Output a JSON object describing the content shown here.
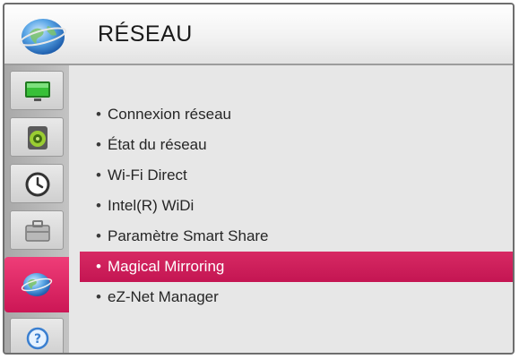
{
  "header": {
    "title": "RÉSEAU",
    "icon": "network-globe-icon"
  },
  "sidebar": {
    "items": [
      {
        "icon": "picture-tv-icon",
        "active": false
      },
      {
        "icon": "audio-speaker-icon",
        "active": false
      },
      {
        "icon": "time-clock-icon",
        "active": false
      },
      {
        "icon": "options-briefcase-icon",
        "active": false
      },
      {
        "icon": "network-globe-icon",
        "active": true
      },
      {
        "icon": "help-question-icon",
        "active": false
      }
    ]
  },
  "menu": {
    "items": [
      {
        "label": "Connexion réseau",
        "selected": false
      },
      {
        "label": "État du réseau",
        "selected": false
      },
      {
        "label": "Wi-Fi Direct",
        "selected": false
      },
      {
        "label": "Intel(R) WiDi",
        "selected": false
      },
      {
        "label": "Paramètre Smart Share",
        "selected": false
      },
      {
        "label": "Magical Mirroring",
        "selected": true
      },
      {
        "label": "eZ-Net Manager",
        "selected": false
      }
    ]
  },
  "colors": {
    "accent": "#d72a64",
    "content_bg": "#e7e7e7",
    "sidebar_bg": "#b9b9b9"
  }
}
